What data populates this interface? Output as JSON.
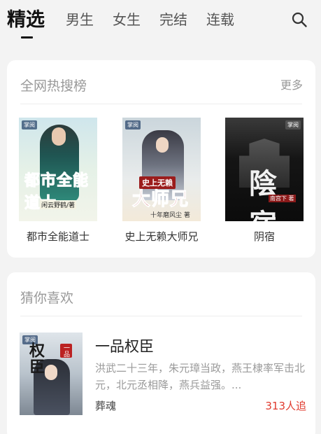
{
  "tabs": [
    {
      "label": "精选",
      "active": true
    },
    {
      "label": "男生"
    },
    {
      "label": "女生"
    },
    {
      "label": "完结"
    },
    {
      "label": "连载"
    }
  ],
  "hot": {
    "title": "全网热搜榜",
    "more": "更多",
    "books": [
      {
        "name": "都市全能道士",
        "cover_title": "都市全能道士",
        "cover_author": "闲云野鹤/著",
        "badge": "掌阅"
      },
      {
        "name": "史上无赖大师兄",
        "cover_banner": "史上无赖",
        "cover_title": "大师兄",
        "cover_author": "十年磨风尘 著",
        "badge": "掌阅"
      },
      {
        "name": "阴宿",
        "cover_title": "陰宿",
        "cover_author": "南宫下 著",
        "badge": "掌阅"
      }
    ]
  },
  "guess": {
    "title": "猜你喜欢",
    "book": {
      "title": "一品权臣",
      "cover_title": "权臣",
      "cover_seal": "一品",
      "badge": "掌阅",
      "desc": "洪武二十三年，朱元璋当政，燕王棣率军击北元，北元丞相降，燕兵益强。...",
      "author": "葬魂",
      "count": "313人追"
    }
  }
}
